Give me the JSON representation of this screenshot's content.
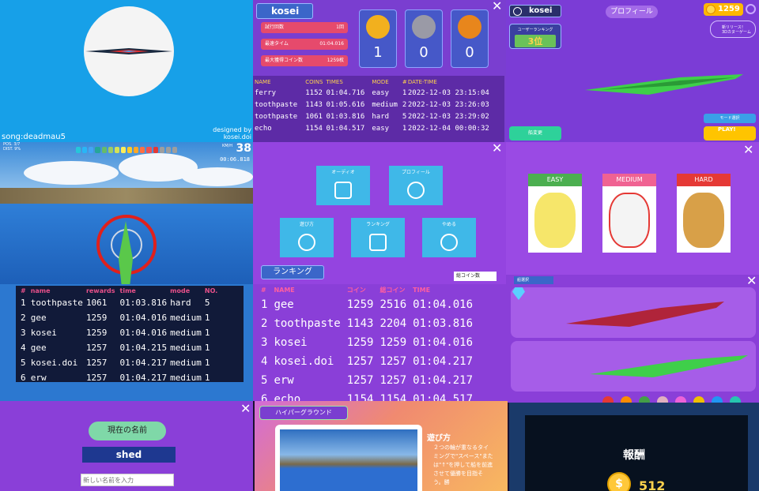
{
  "panel1": {
    "song": "song:deadmau5",
    "credit_line1": "designed by",
    "credit_line2": "kosei.doi"
  },
  "panel2": {
    "tab": "kosei",
    "stats": [
      {
        "label": "試行回数",
        "value": "1回"
      },
      {
        "label": "最速タイム",
        "value": "01:04.016"
      },
      {
        "label": "最大獲得コイン数",
        "value": "1259枚"
      }
    ],
    "medals": [
      {
        "count": "1",
        "color": "#f2b01e"
      },
      {
        "count": "0",
        "color": "#9a9aa6"
      },
      {
        "count": "0",
        "color": "#e8861c"
      }
    ],
    "table": {
      "headers": [
        "NAME",
        "COINS",
        "TIMES",
        "MODE",
        "#",
        "DATE-TIME"
      ],
      "rows": [
        [
          "ferry",
          "1152",
          "01:04.716",
          "easy",
          "1",
          "2022-12-03 23:15:04"
        ],
        [
          "toothpaste",
          "1143",
          "01:05.616",
          "medium",
          "2",
          "2022-12-03 23:26:03"
        ],
        [
          "toothpaste",
          "1061",
          "01:03.816",
          "hard",
          "5",
          "2022-12-03 23:29:02"
        ],
        [
          "echo",
          "1154",
          "01:04.517",
          "easy",
          "1",
          "2022-12-04 00:00:32"
        ]
      ]
    }
  },
  "panel3": {
    "user": "kosei",
    "title": "プロフィール",
    "coins": "1259",
    "ranking_label": "ユーザーランキング",
    "ranking_value": "3位",
    "news_line1": "新リリース！",
    "news_line2": "3Dカヌーゲーム",
    "change_button": "船変更",
    "mode_button": "モード選択",
    "play_button": "PLAY!"
  },
  "panel4": {
    "pos_label": "POS.",
    "pos_value": "3/7",
    "dist_label": "DIST.",
    "dist_value": "9%",
    "speed": "38",
    "speed_unit": "KM/H",
    "timer": "00:06.818",
    "bar_colors": [
      "#26c6da",
      "#29b6f6",
      "#42a5f5",
      "#26a69a",
      "#66bb6a",
      "#9ccc65",
      "#d4e157",
      "#ffee58",
      "#ffca28",
      "#ffa726",
      "#ff7043",
      "#ef5350",
      "#e53935",
      "#9e9e9e",
      "#9e9e9e",
      "#9e9e9e"
    ]
  },
  "panel5": {
    "buttons": [
      {
        "label": "オーディオ"
      },
      {
        "label": "プロフィール"
      },
      {
        "label": "遊び方"
      },
      {
        "label": "ランキング"
      },
      {
        "label": "やめる"
      }
    ],
    "ranking_tab": "ランキング",
    "sort_select": "総コイン数"
  },
  "panel6": {
    "cards": [
      {
        "label": "EASY",
        "color": "#4caf50",
        "art": "#f6e66a"
      },
      {
        "label": "MEDIUM",
        "color": "#f06292",
        "art": "#f4f4f4"
      },
      {
        "label": "HARD",
        "color": "#e53935",
        "art": "#d8a048"
      }
    ]
  },
  "panel7": {
    "headers": [
      "#",
      "name",
      "rewards",
      "time",
      "mode",
      "NO."
    ],
    "rows": [
      [
        "1",
        "toothpaste",
        "1061",
        "01:03.816",
        "hard",
        "5"
      ],
      [
        "2",
        "gee",
        "1259",
        "01:04.016",
        "medium",
        "1"
      ],
      [
        "3",
        "kosei",
        "1259",
        "01:04.016",
        "medium",
        "1"
      ],
      [
        "4",
        "gee",
        "1257",
        "01:04.215",
        "medium",
        "1"
      ],
      [
        "5",
        "kosei.doi",
        "1257",
        "01:04.217",
        "medium",
        "1"
      ],
      [
        "6",
        "erw",
        "1257",
        "01:04.217",
        "medium",
        "1"
      ]
    ]
  },
  "panel8": {
    "headers": [
      "#",
      "NAME",
      "コイン",
      "総コイン",
      "TIME"
    ],
    "rows": [
      [
        "1",
        "gee",
        "1259",
        "2516",
        "01:04.016"
      ],
      [
        "2",
        "toothpaste",
        "1143",
        "2204",
        "01:03.816"
      ],
      [
        "3",
        "kosei",
        "1259",
        "1259",
        "01:04.016"
      ],
      [
        "4",
        "kosei.doi",
        "1257",
        "1257",
        "01:04.217"
      ],
      [
        "5",
        "erw",
        "1257",
        "1257",
        "01:04.217"
      ],
      [
        "6",
        "echo",
        "1154",
        "1154",
        "01:04.517"
      ]
    ]
  },
  "panel9": {
    "ship_tab": "船選択",
    "boat_colors": [
      "#b0243a",
      "#3fcf4a"
    ],
    "dots": [
      "#e53935",
      "#fb8c00",
      "#43a047",
      "#e0b0c0",
      "#ec62d8",
      "#f0c000",
      "#2196f3",
      "#26c6b0"
    ]
  },
  "panel10": {
    "label": "現在の名前",
    "name": "shed",
    "placeholder": "新しい名前を入力"
  },
  "panel11": {
    "tag": "ハイパーグラウンド",
    "how_title": "遊び方",
    "how_text": "２つの輪が重なるタイミングで\"スペース\"または\"↑\"を押して船を前進させて優勝を目指そう。勝"
  },
  "panel12": {
    "title": "報酬",
    "value": "512"
  }
}
